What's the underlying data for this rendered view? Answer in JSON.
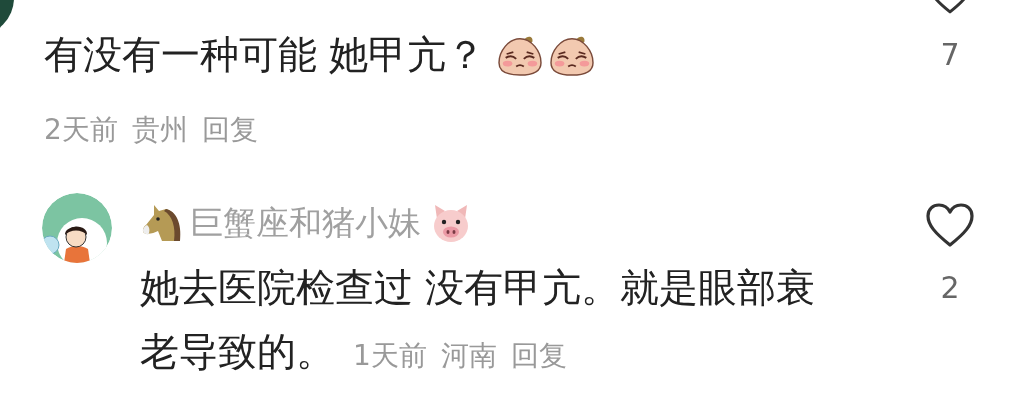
{
  "comments": [
    {
      "text": "有没有一种可能 她甲亢？",
      "stickers": [
        {
          "kind": "crying"
        },
        {
          "kind": "crying"
        }
      ],
      "time": "2天前",
      "location": "贵州",
      "reply": "回复",
      "likes": "7",
      "liked": false
    },
    {
      "name": {
        "text": "巨蟹座和猪小妹",
        "icons_before": [
          {
            "kind": "horse"
          }
        ],
        "icons_after": [
          {
            "kind": "pig"
          }
        ]
      },
      "text": "她去医院检查过 没有甲亢。就是眼部衰老导致的。",
      "time": "1天前",
      "location": "河南",
      "reply": "回复",
      "likes": "2",
      "liked": false
    }
  ]
}
